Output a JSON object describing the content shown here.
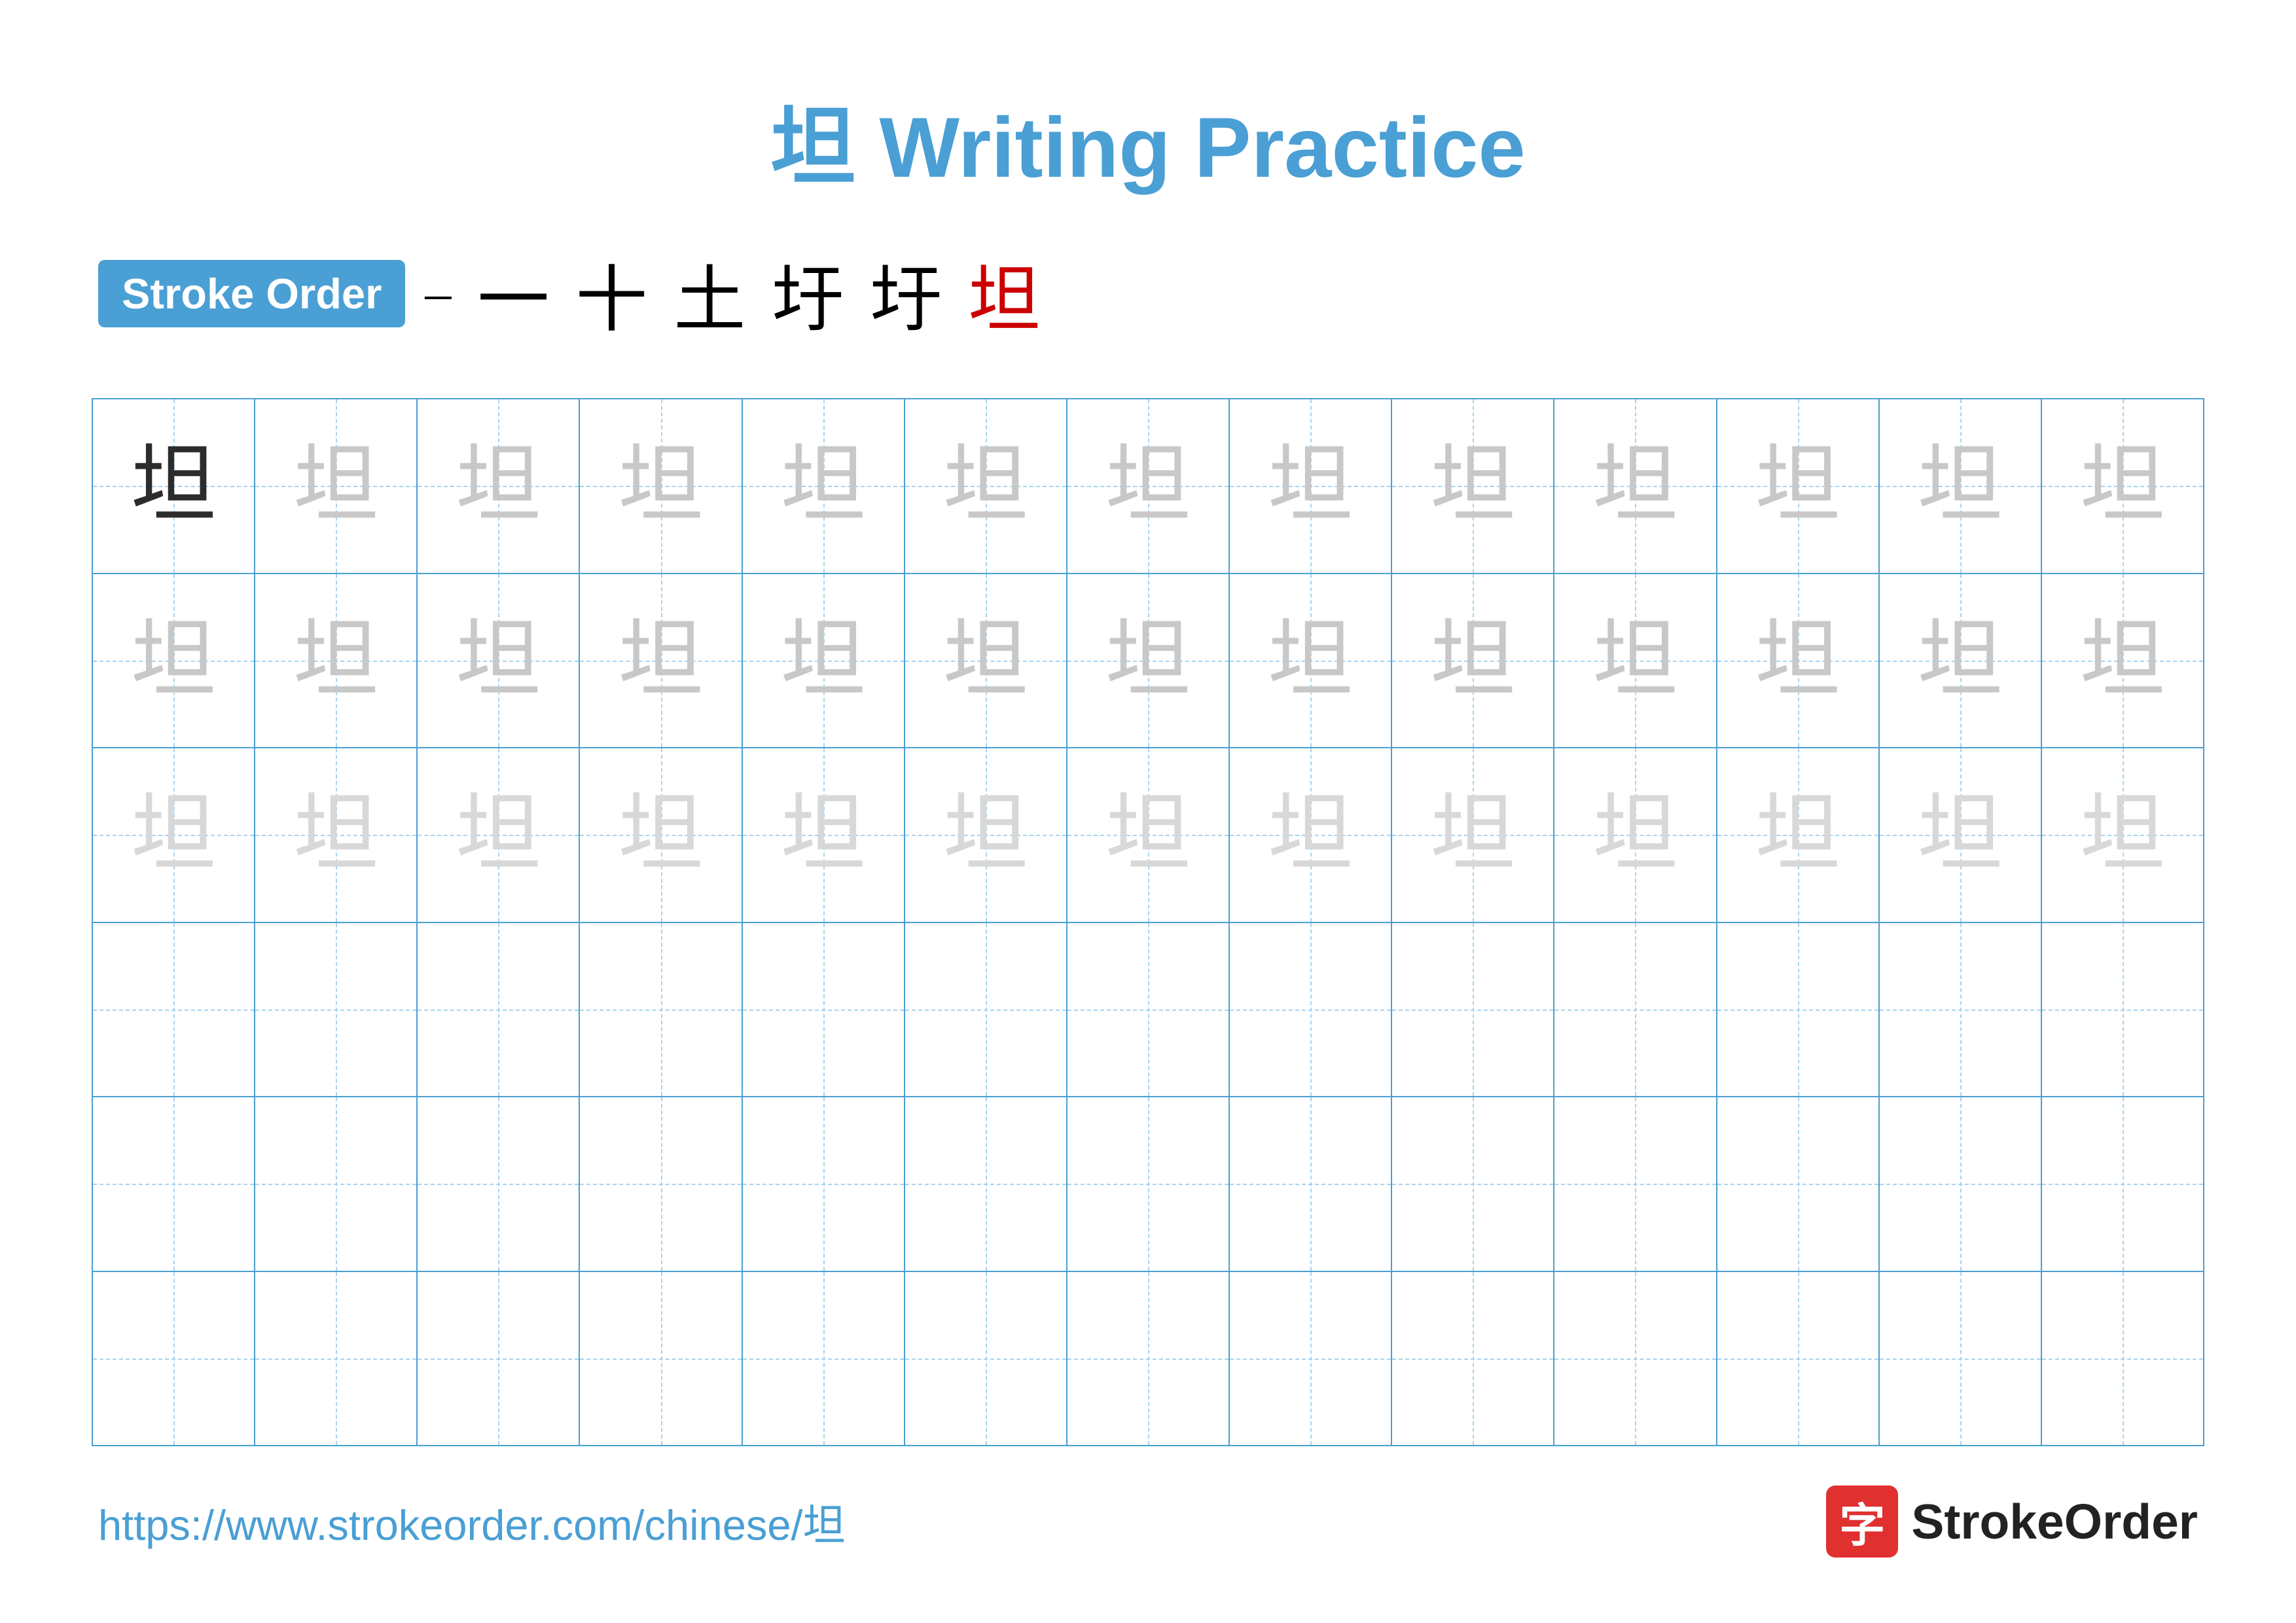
{
  "title": {
    "char": "坦",
    "text": "Writing Practice"
  },
  "stroke_order": {
    "badge_label": "Stroke Order",
    "separator": "–",
    "steps": [
      "一",
      "十",
      "土",
      "圩",
      "圩",
      "坦"
    ]
  },
  "grid": {
    "rows": 6,
    "cols": 13,
    "char": "坦",
    "row_types": [
      "dark",
      "light",
      "lighter",
      "empty",
      "empty",
      "empty"
    ]
  },
  "footer": {
    "url": "https://www.strokeorder.com/chinese/坦",
    "brand_icon": "字",
    "brand_name": "StrokeOrder"
  }
}
